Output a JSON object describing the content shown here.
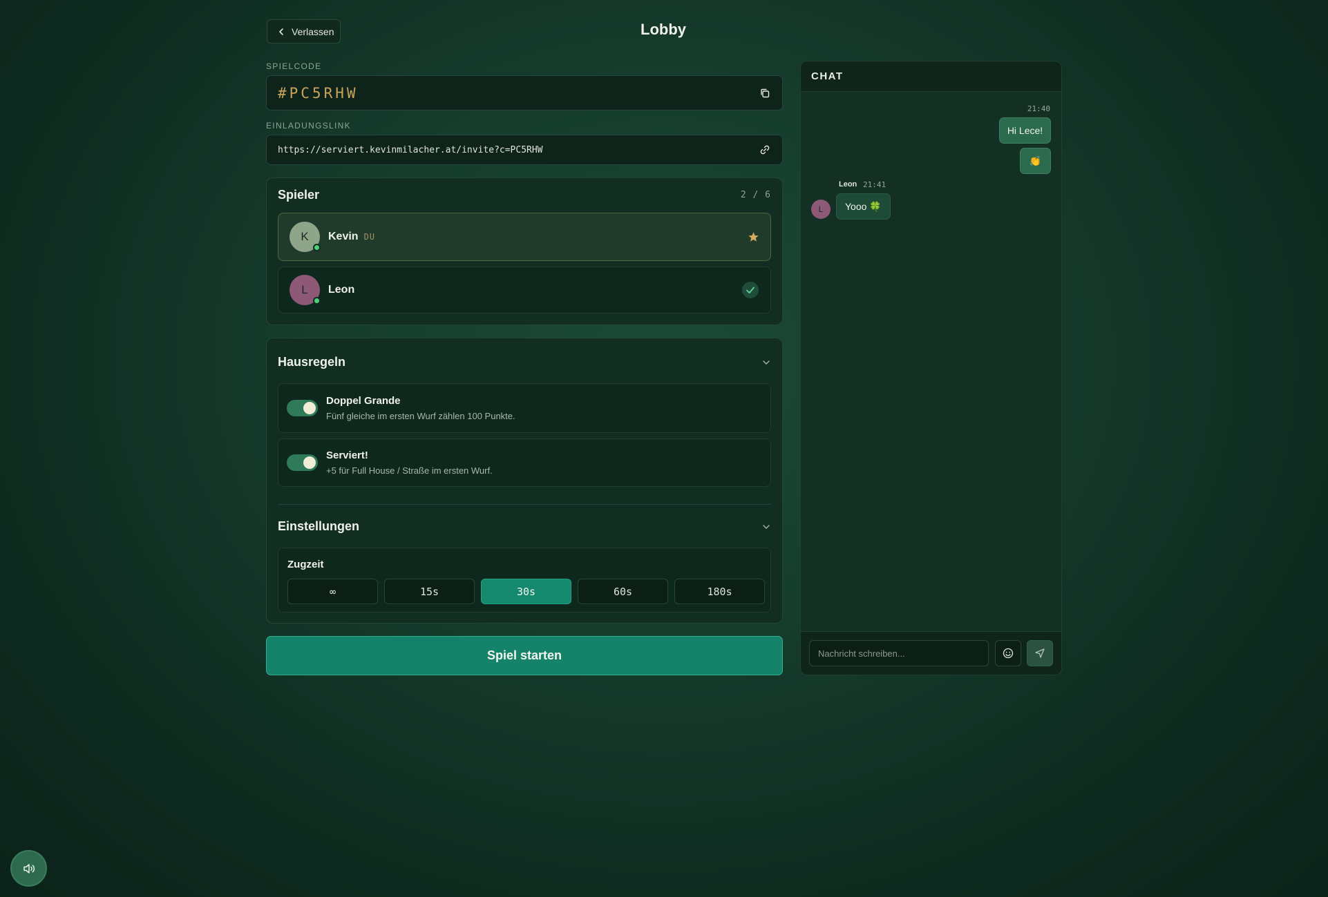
{
  "header": {
    "back_label": "Verlassen",
    "title": "Lobby"
  },
  "game_code": {
    "label": "SPIELCODE",
    "value": "#PC5RHW"
  },
  "invite": {
    "label": "EINLADUNGSLINK",
    "url": "https://serviert.kevinmilacher.at/invite?c=PC5RHW"
  },
  "players": {
    "title": "Spieler",
    "count": "2 / 6",
    "list": [
      {
        "initial": "K",
        "name": "Kevin",
        "tag": "DU",
        "avatar_color": "#8fa58a",
        "status_icon": "star-icon"
      },
      {
        "initial": "L",
        "name": "Leon",
        "tag": "",
        "avatar_color": "#8e5877",
        "status_icon": "check-icon"
      }
    ]
  },
  "house_rules": {
    "title": "Hausregeln",
    "rules": [
      {
        "title": "Doppel Grande",
        "description": "Fünf gleiche im ersten Wurf zählen 100 Punkte.",
        "enabled": true
      },
      {
        "title": "Serviert!",
        "description": "+5 für Full House / Straße im ersten Wurf.",
        "enabled": true
      }
    ]
  },
  "settings": {
    "title": "Einstellungen",
    "turn_time_label": "Zugzeit",
    "turn_time_options": [
      "∞",
      "15s",
      "30s",
      "60s",
      "180s"
    ],
    "turn_time_selected": "30s"
  },
  "start_button": "Spiel starten",
  "chat": {
    "title": "CHAT",
    "messages": [
      {
        "mine": true,
        "time": "21:40",
        "text": "Hi Lece!"
      },
      {
        "mine": true,
        "time": "",
        "text": "👏"
      },
      {
        "mine": false,
        "sender": "Leon",
        "initial": "L",
        "time": "21:41",
        "text": "Yooo 🍀"
      }
    ],
    "input_placeholder": "Nachricht schreiben..."
  },
  "colors": {
    "accent": "#15836a",
    "gold": "#c9a45a",
    "online": "#4bd07c"
  }
}
